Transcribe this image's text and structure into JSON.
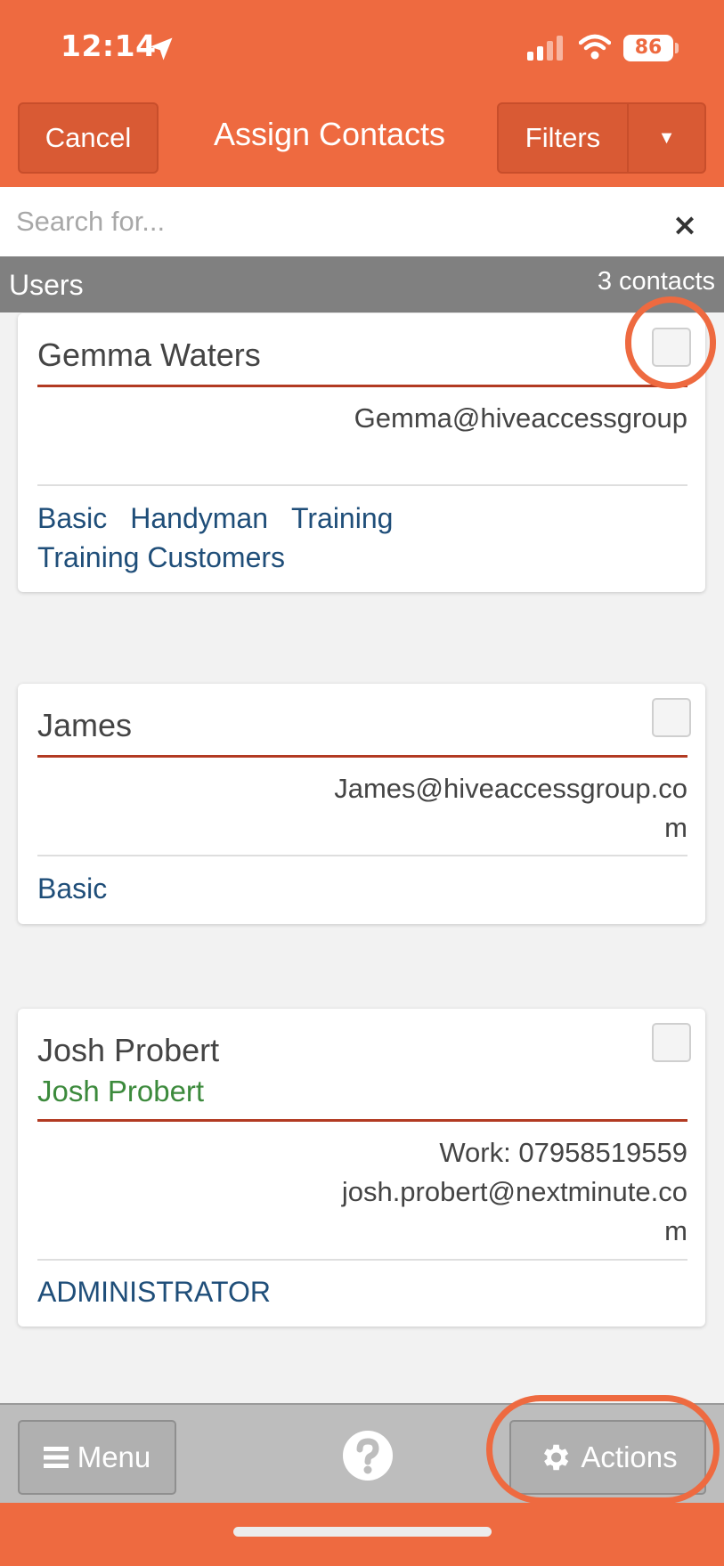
{
  "status_bar": {
    "time": "12:14",
    "battery": "86"
  },
  "header": {
    "cancel_label": "Cancel",
    "title": "Assign Contacts",
    "filters_label": "Filters",
    "dropdown_glyph": "▼"
  },
  "search": {
    "placeholder": "Search for...",
    "value": "",
    "clear_glyph": "×"
  },
  "section": {
    "title": "Users",
    "count": "3 contacts"
  },
  "contacts": [
    {
      "name": "Gemma Waters",
      "details": [
        "Gemma@hiveaccessgroup"
      ],
      "tags": [
        "Basic",
        "Handyman",
        "Training",
        "Training Customers"
      ],
      "checked": false
    },
    {
      "name": "James",
      "details": [
        "James@hiveaccessgroup.com"
      ],
      "tags": [
        "Basic"
      ],
      "checked": false
    },
    {
      "name": "Josh Probert",
      "subname": "Josh Probert",
      "details": [
        "Work: 07958519559",
        "josh.probert@nextminute.com"
      ],
      "tags": [
        "ADMINISTRATOR"
      ],
      "checked": false
    }
  ],
  "footer": {
    "menu_label": "Menu",
    "actions_label": "Actions"
  },
  "colors": {
    "brand_orange": "#ee6a40",
    "tag_blue": "#1f4e79",
    "divider_red": "#b23a22",
    "subname_green": "#3c8a3c"
  },
  "icons": [
    "location-arrow-icon",
    "signal-icon",
    "wifi-icon",
    "close-icon",
    "hamburger-icon",
    "help-icon",
    "gear-icon"
  ]
}
